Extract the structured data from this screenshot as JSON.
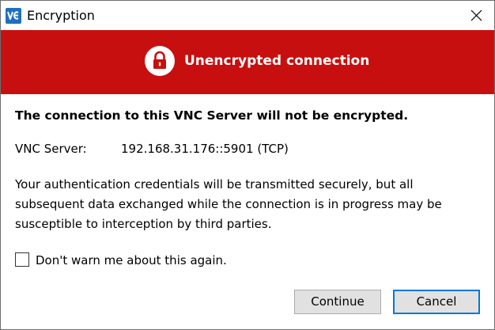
{
  "window": {
    "title": "Encryption",
    "app_icon": "vnc-viewer-logo-icon",
    "close_icon": "close-icon"
  },
  "banner": {
    "title": "Unencrypted connection",
    "icon": "lock-icon",
    "background_color": "#c80f0f"
  },
  "content": {
    "heading": "The connection to this VNC Server will not be encrypted.",
    "server_label": "VNC Server:",
    "server_value": "192.168.31.176::5901 (TCP)",
    "description_lines": [
      "Your authentication credentials will be transmitted securely, but all",
      "subsequent data exchanged while the connection is in progress may be",
      "susceptible to interception by third parties."
    ]
  },
  "checkbox": {
    "label": "Don't warn me about this again.",
    "checked": false
  },
  "buttons": {
    "continue_label": "Continue",
    "cancel_label": "Cancel"
  }
}
